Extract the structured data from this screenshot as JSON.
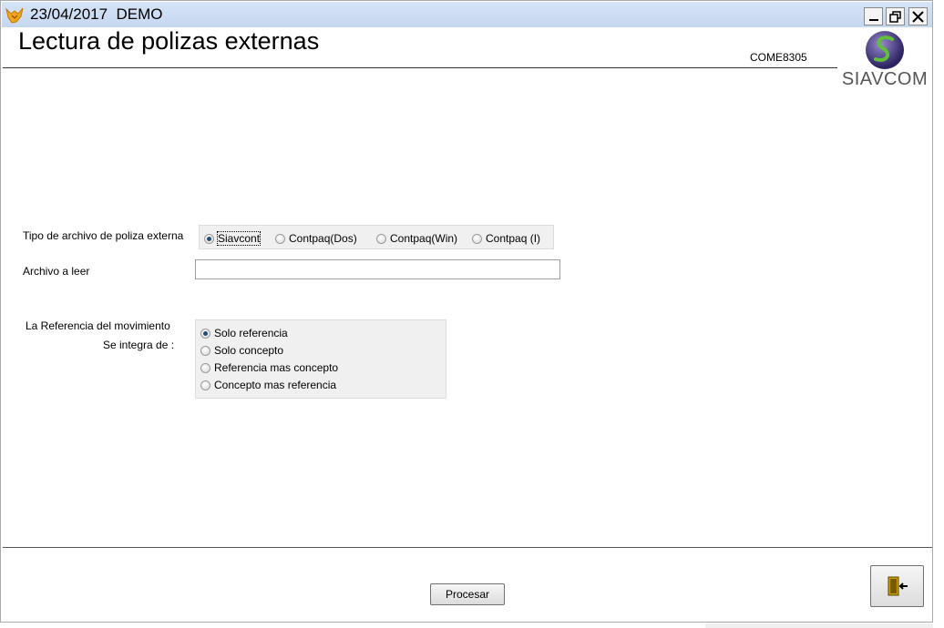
{
  "window": {
    "title": "23/04/2017  DEMO",
    "app_icon": "fox-icon",
    "controls": [
      "minimize-icon",
      "restore-icon",
      "close-icon"
    ]
  },
  "header": {
    "title": "Lectura de polizas externas",
    "code": "COME8305",
    "logo_text": "SIAVCOM"
  },
  "form": {
    "tipo_label": "Tipo de archivo de poliza externa",
    "tipo_options": [
      {
        "label": "Siavcont",
        "selected": true
      },
      {
        "label": "Contpaq(Dos)",
        "selected": false
      },
      {
        "label": "Contpaq(Win)",
        "selected": false
      },
      {
        "label": "Contpaq (I)",
        "selected": false
      }
    ],
    "archivo_label": "Archivo a leer",
    "archivo_value": "",
    "referencia_label_1": "La Referencia del movimiento",
    "referencia_label_2": "Se integra de :",
    "referencia_options": [
      {
        "label": "Solo referencia",
        "selected": true
      },
      {
        "label": "Solo concepto",
        "selected": false
      },
      {
        "label": "Referencia mas concepto",
        "selected": false
      },
      {
        "label": "Concepto mas referencia",
        "selected": false
      }
    ]
  },
  "footer": {
    "procesar_label": "Procesar",
    "exit_icon": "exit-door-icon"
  },
  "colors": {
    "titlebar": "#c5d7ef",
    "group_bg": "#f0f0f0",
    "radio_dot": "#1f4e79"
  }
}
